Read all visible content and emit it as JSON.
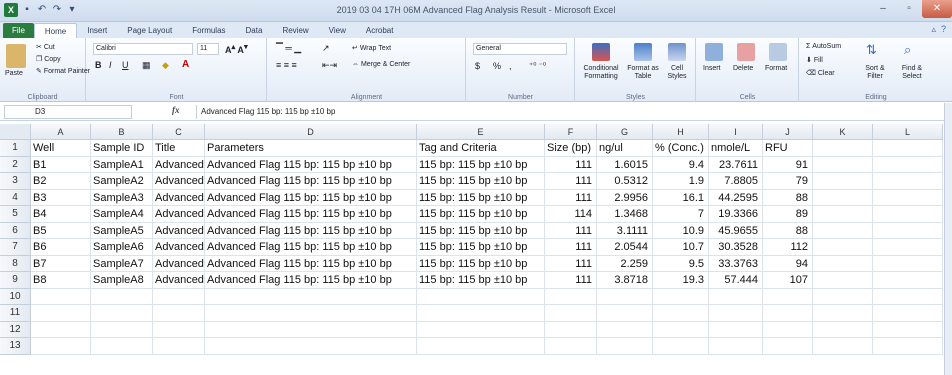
{
  "window": {
    "title": "2019 03 04 17H 06M Advanced Flag Analysis Result - Microsoft Excel"
  },
  "tabs": [
    "File",
    "Home",
    "Insert",
    "Page Layout",
    "Formulas",
    "Data",
    "Review",
    "View",
    "Acrobat"
  ],
  "active_tab": "Home",
  "ribbon": {
    "clipboard": {
      "label": "Clipboard",
      "paste": "Paste",
      "cut": "Cut",
      "copy": "Copy",
      "format_painter": "Format Painter"
    },
    "font": {
      "label": "Font",
      "name": "Calibri",
      "size": "11",
      "bold": "B",
      "italic": "I",
      "underline": "U"
    },
    "alignment": {
      "label": "Alignment",
      "wrap": "Wrap Text",
      "merge": "Merge & Center"
    },
    "number": {
      "label": "Number",
      "format": "General",
      "currency": "$",
      "percent": "%",
      "comma": ","
    },
    "styles": {
      "label": "Styles",
      "conditional": "Conditional Formatting",
      "format_table": "Format as Table",
      "cell_styles": "Cell Styles"
    },
    "cells": {
      "label": "Cells",
      "insert": "Insert",
      "delete": "Delete",
      "format": "Format"
    },
    "editing": {
      "label": "Editing",
      "autosum": "AutoSum",
      "fill": "Fill",
      "clear": "Clear",
      "sort": "Sort & Filter",
      "find": "Find & Select"
    }
  },
  "formula_bar": {
    "name_box": "D3",
    "fx": "fx",
    "content": "Advanced Flag 115 bp:  115 bp ±10 bp"
  },
  "sheet": {
    "columns": [
      "A",
      "B",
      "C",
      "D",
      "E",
      "F",
      "G",
      "H",
      "I",
      "J",
      "K",
      "L"
    ],
    "row_numbers": [
      "1",
      "2",
      "3",
      "4",
      "5",
      "6",
      "7",
      "8",
      "9",
      "10",
      "11",
      "12",
      "13"
    ],
    "headers": [
      "Well",
      "Sample ID",
      "Title",
      "Parameters",
      "Tag and Criteria",
      "Size (bp)",
      "ng/ul",
      "% (Conc.)",
      "nmole/L",
      "RFU"
    ],
    "rows": [
      [
        "B1",
        "SampleA1",
        "Advanced",
        "Advanced Flag 115 bp:  115 bp ±10 bp",
        "115 bp: 115 bp ±10 bp",
        "111",
        "1.6015",
        "9.4",
        "23.7611",
        "91"
      ],
      [
        "B2",
        "SampleA2",
        "Advanced",
        "Advanced Flag 115 bp:  115 bp ±10 bp",
        "115 bp: 115 bp ±10 bp",
        "111",
        "0.5312",
        "1.9",
        "7.8805",
        "79"
      ],
      [
        "B3",
        "SampleA3",
        "Advanced",
        "Advanced Flag 115 bp:  115 bp ±10 bp",
        "115 bp: 115 bp ±10 bp",
        "111",
        "2.9956",
        "16.1",
        "44.2595",
        "88"
      ],
      [
        "B4",
        "SampleA4",
        "Advanced",
        "Advanced Flag 115 bp:  115 bp ±10 bp",
        "115 bp: 115 bp ±10 bp",
        "114",
        "1.3468",
        "7",
        "19.3366",
        "89"
      ],
      [
        "B5",
        "SampleA5",
        "Advanced",
        "Advanced Flag 115 bp:  115 bp ±10 bp",
        "115 bp: 115 bp ±10 bp",
        "111",
        "3.1111",
        "10.9",
        "45.9655",
        "88"
      ],
      [
        "B6",
        "SampleA6",
        "Advanced",
        "Advanced Flag 115 bp:  115 bp ±10 bp",
        "115 bp: 115 bp ±10 bp",
        "111",
        "2.0544",
        "10.7",
        "30.3528",
        "112"
      ],
      [
        "B7",
        "SampleA7",
        "Advanced",
        "Advanced Flag 115 bp:  115 bp ±10 bp",
        "115 bp: 115 bp ±10 bp",
        "111",
        "2.259",
        "9.5",
        "33.3763",
        "94"
      ],
      [
        "B8",
        "SampleA8",
        "Advanced",
        "Advanced Flag 115 bp:  115 bp ±10 bp",
        "115 bp: 115 bp ±10 bp",
        "111",
        "3.8718",
        "19.3",
        "57.444",
        "107"
      ]
    ]
  }
}
